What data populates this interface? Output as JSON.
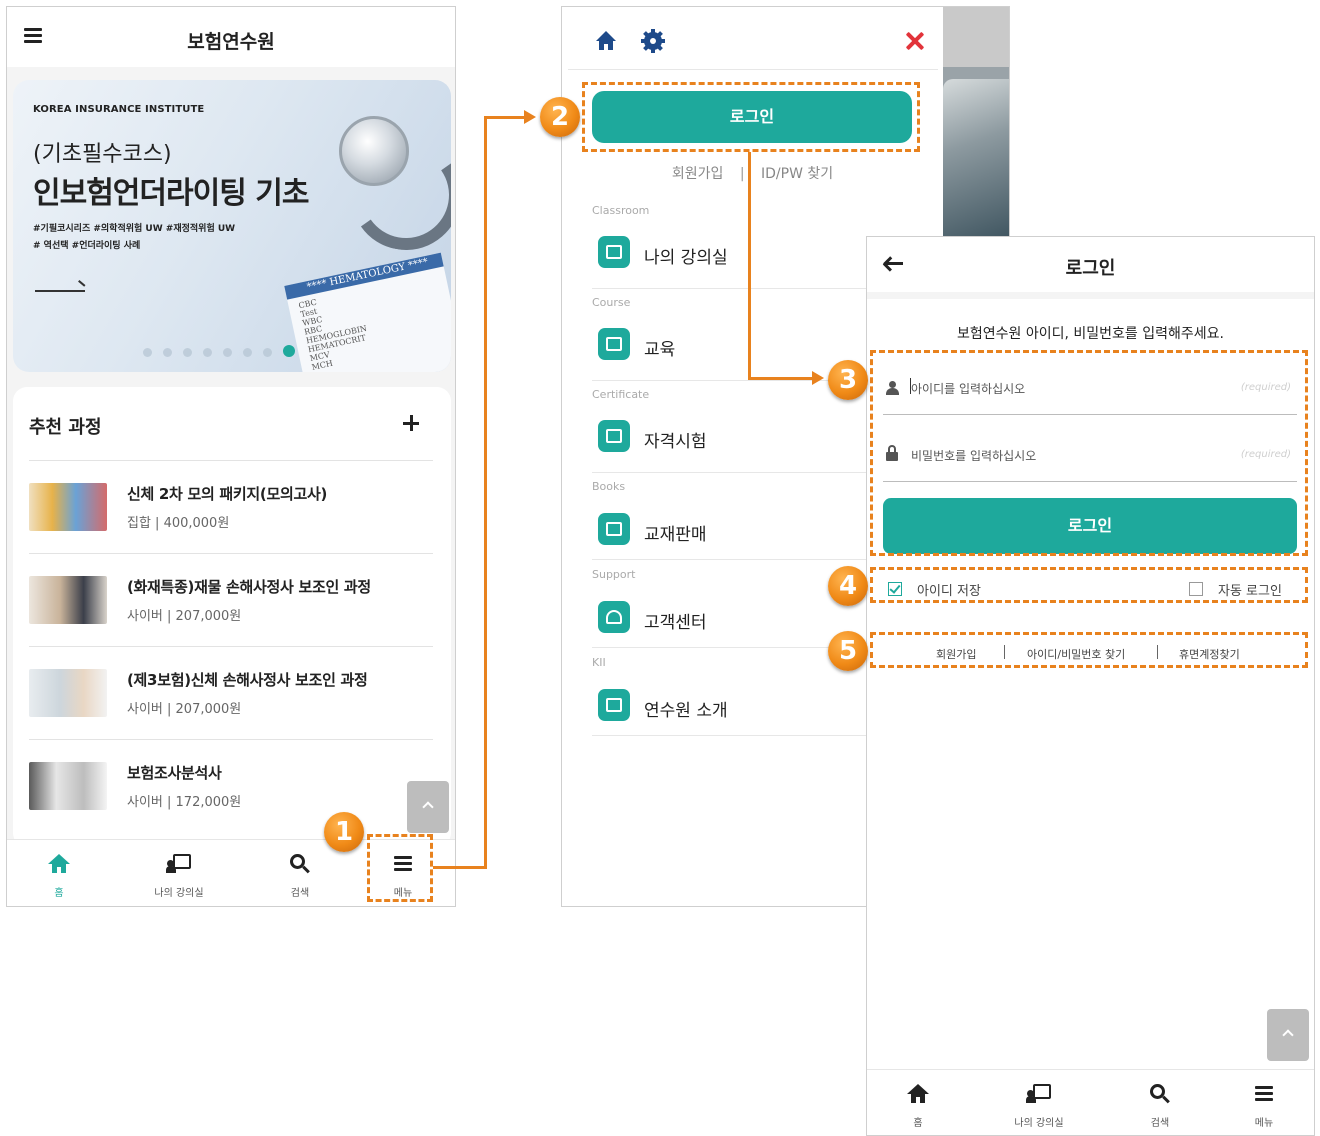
{
  "screen1": {
    "title": "보험연수원",
    "banner": {
      "institute": "KOREA INSURANCE INSTITUTE",
      "subtitle": "(기초필수코스)",
      "headline": "인보험언더라이팅 기초",
      "tags_line1": "#기필코시리즈  #의학적위험 UW  #재정적위험 UW",
      "tags_line2": "# 역선택  #언더라이팅 사례",
      "sheet_header": "**** HEMATOLOGY ****",
      "sheet_lines": [
        "CBC",
        "Test",
        "WBC",
        "RBC",
        "HEMOGLOBIN",
        "HEMATOCRIT",
        "MCV",
        "MCH"
      ]
    },
    "recommend_title": "추천 과정",
    "courses": [
      {
        "name": "신체 2차 모의 패키지(모의고사)",
        "meta": "집합 | 400,000원"
      },
      {
        "name": "(화재특종)재물 손해사정사 보조인 과정",
        "meta": "사이버 | 207,000원"
      },
      {
        "name": "(제3보험)신체 손해사정사 보조인 과정",
        "meta": "사이버 | 207,000원"
      },
      {
        "name": "보험조사분석사",
        "meta": "사이버 | 172,000원"
      }
    ],
    "nav": [
      {
        "label": "홈",
        "icon": "home-icon"
      },
      {
        "label": "나의 강의실",
        "icon": "classroom-icon"
      },
      {
        "label": "검색",
        "icon": "search-icon"
      },
      {
        "label": "메뉴",
        "icon": "menu-icon"
      }
    ]
  },
  "screen2": {
    "login_label": "로그인",
    "join_label": "회원가입",
    "separator": "|",
    "find_label": "ID/PW 찾기",
    "menu": [
      {
        "category": "Classroom",
        "label": "나의 강의실",
        "icon": "classroom-icon"
      },
      {
        "category": "Course",
        "label": "교육",
        "icon": "list-icon"
      },
      {
        "category": "Certificate",
        "label": "자격시험",
        "icon": "certificate-icon"
      },
      {
        "category": "Books",
        "label": "교재판매",
        "icon": "book-icon"
      },
      {
        "category": "Support",
        "label": "고객센터",
        "icon": "headset-icon"
      },
      {
        "category": "KII",
        "label": "연수원 소개",
        "icon": "building-icon"
      }
    ]
  },
  "screen3": {
    "title": "로그인",
    "prompt": "보험연수원 아이디, 비밀번호를 입력해주세요.",
    "id_placeholder": "아이디를 입력하십시오",
    "pw_placeholder": "비밀번호를 입력하십시오",
    "required_hint": "(required)",
    "login_label": "로그인",
    "save_id_label": "아이디 저장",
    "save_id_checked": true,
    "auto_login_label": "자동 로그인",
    "auto_login_checked": false,
    "links": [
      "회원가입",
      "아이디/비밀번호 찾기",
      "휴면계정찾기"
    ],
    "nav": [
      {
        "label": "홈",
        "icon": "home-icon"
      },
      {
        "label": "나의 강의실",
        "icon": "classroom-icon"
      },
      {
        "label": "검색",
        "icon": "search-icon"
      },
      {
        "label": "메뉴",
        "icon": "menu-icon"
      }
    ]
  },
  "callouts": [
    "1",
    "2",
    "3",
    "4",
    "5"
  ],
  "colors": {
    "accent": "#1ea99c",
    "callout": "#e8821e",
    "close": "#e2333a",
    "gear": "#1e4a8a"
  }
}
